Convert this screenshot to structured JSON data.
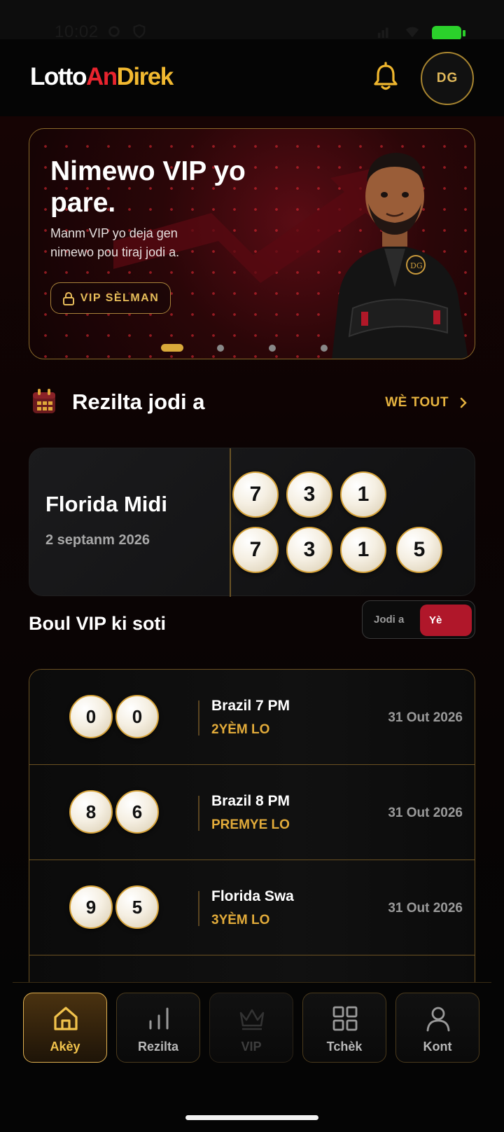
{
  "status_bar": {
    "time": "10:02",
    "battery_color": "#2bd12b"
  },
  "header": {
    "logo_part1": "Lotto",
    "logo_part2": "An",
    "logo_part3": "Direk",
    "avatar_initials": "DG",
    "notification_icon": "bell-icon"
  },
  "banner": {
    "title": "Nimewo VIP yo pare.",
    "subtitle": "Manm VIP yo deja gen nimewo pou tiraj jodi a.",
    "button_label": "VIP SÈLMAN",
    "button_icon": "lock-icon",
    "page_count": 4,
    "active_page": 1
  },
  "results_section": {
    "title": "Rezilta jodi a",
    "see_all_label": "WÈ TOUT",
    "card": {
      "name": "Florida Midi",
      "date": "2 septanm 2026",
      "row1": [
        "7",
        "3",
        "1"
      ],
      "row2": [
        "7",
        "3",
        "1",
        "5"
      ]
    }
  },
  "vip_section": {
    "title": "Boul VIP ki soti",
    "toggle_option1": "Jodi a",
    "toggle_option2": "Yè",
    "selected_toggle": "Yè",
    "rows": [
      {
        "balls": [
          "0",
          "0"
        ],
        "name": "Brazil 7 PM",
        "tier": "2YÈM LO",
        "date": "31 Out 2026"
      },
      {
        "balls": [
          "8",
          "6"
        ],
        "name": "Brazil 8 PM",
        "tier": "PREMYE LO",
        "date": "31 Out 2026"
      },
      {
        "balls": [
          "9",
          "5"
        ],
        "name": "Florida Swa",
        "tier": "3YÈM LO",
        "date": "31 Out 2026"
      }
    ]
  },
  "bottom_nav": {
    "items": [
      {
        "label": "Akèy",
        "icon": "home-icon",
        "active": true
      },
      {
        "label": "Rezilta",
        "icon": "bar-chart-icon",
        "active": false
      },
      {
        "label": "VIP",
        "icon": "crown-icon",
        "active": false
      },
      {
        "label": "Tchèk",
        "icon": "grid-icon",
        "active": false
      },
      {
        "label": "Kont",
        "icon": "user-icon",
        "active": false
      }
    ]
  },
  "colors": {
    "accent_gold": "#e6b33f",
    "accent_red": "#b0172a",
    "logo_red": "#e8242e"
  }
}
